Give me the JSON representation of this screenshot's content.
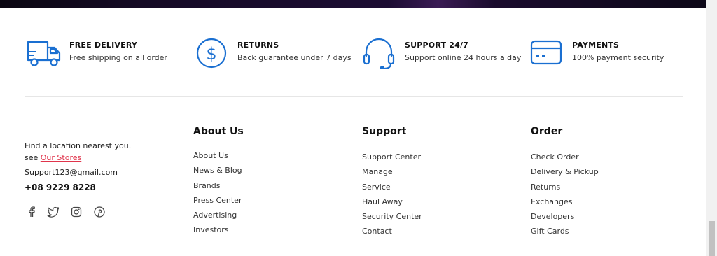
{
  "features": [
    {
      "title": "FREE DELIVERY",
      "desc": "Free shipping on all order",
      "icon": "truck-icon"
    },
    {
      "title": "RETURNS",
      "desc": "Back guarantee under 7 days",
      "icon": "dollar-circle-icon"
    },
    {
      "title": "SUPPORT 24/7",
      "desc": "Support online 24 hours a day",
      "icon": "headset-icon"
    },
    {
      "title": "PAYMENTS",
      "desc": "100% payment security",
      "icon": "credit-card-icon"
    }
  ],
  "contact": {
    "line1": "Find a location nearest you.",
    "see": "see ",
    "stores_link": "Our Stores",
    "email": "Support123@gmail.com",
    "phone": "+08 9229 8228"
  },
  "social": [
    "facebook-icon",
    "twitter-icon",
    "instagram-icon",
    "pinterest-icon"
  ],
  "columns": [
    {
      "title": "About Us",
      "items": [
        "About Us",
        "News & Blog",
        "Brands",
        "Press Center",
        "Advertising",
        "Investors"
      ]
    },
    {
      "title": "Support",
      "items": [
        "Support Center",
        "Manage",
        "Service",
        "Haul Away",
        "Security Center",
        "Contact"
      ]
    },
    {
      "title": "Order",
      "items": [
        "Check Order",
        "Delivery & Pickup",
        "Returns",
        "Exchanges",
        "Developers",
        "Gift Cards"
      ]
    }
  ],
  "colors": {
    "accent": "#1a6fd1",
    "link": "#e0344b"
  }
}
